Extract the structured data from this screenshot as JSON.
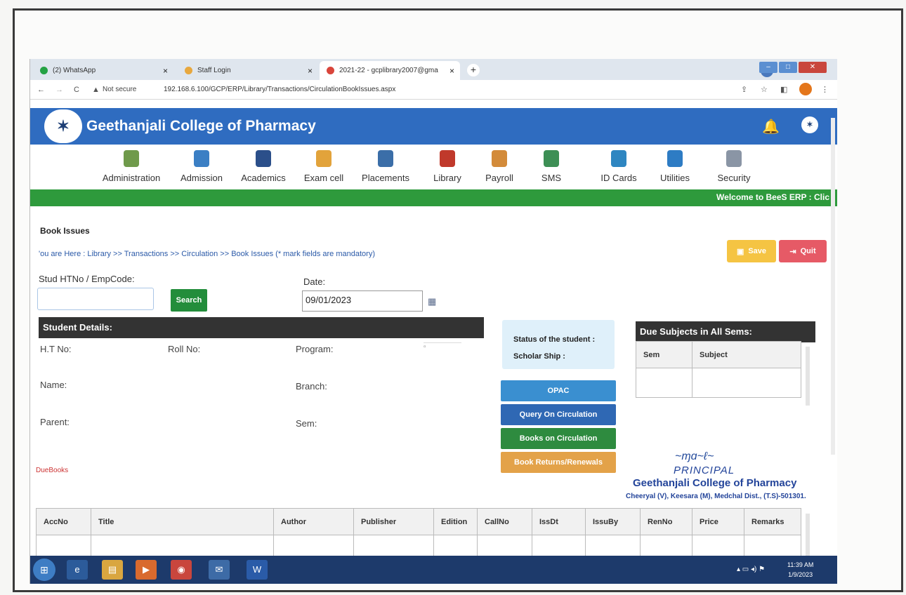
{
  "browser": {
    "tabs": [
      {
        "label": "(2) WhatsApp",
        "icon": "whatsapp-icon",
        "color": "#25a244"
      },
      {
        "label": "Staff Login",
        "icon": "staff-login-icon",
        "color": "#e8a83e"
      },
      {
        "label": "2021-22 - gcplibrary2007@gma",
        "icon": "gmail-icon",
        "color": "#d9453b"
      }
    ],
    "new_tab": "+",
    "not_secure": "Not secure",
    "url": "192.168.6.100/GCP/ERP/Library/Transactions/CirculationBookIssues.aspx"
  },
  "header": {
    "college_name": "Geethanjali College of Pharmacy"
  },
  "menu": [
    {
      "label": "Administration",
      "color": "#6f9a4b"
    },
    {
      "label": "Admission",
      "color": "#3b7fc4"
    },
    {
      "label": "Academics",
      "color": "#2b4f8a"
    },
    {
      "label": "Exam cell",
      "color": "#e2a33b"
    },
    {
      "label": "Placements",
      "color": "#3b6ea8"
    },
    {
      "label": "Library",
      "color": "#c0392b"
    },
    {
      "label": "Payroll",
      "color": "#d38b3a"
    },
    {
      "label": "SMS",
      "color": "#3d8f55"
    },
    {
      "label": "ID Cards",
      "color": "#2e86c1"
    },
    {
      "label": "Utilities",
      "color": "#2e7cc4"
    },
    {
      "label": "Security",
      "color": "#8a95a5"
    }
  ],
  "welcome": "Welcome to BeeS ERP : Clic",
  "page": {
    "title": "Book Issues",
    "breadcrumb": "'ou are Here : Library >> Transactions >> Circulation >> Book Issues (* mark fields are mandatory)",
    "save_label": "Save",
    "quit_label": "Quit",
    "htno_label": "Stud HTNo / EmpCode:",
    "search_label": "Search",
    "date_label": "Date:",
    "date_value": "09/01/2023"
  },
  "student": {
    "section_title": "Student Details:",
    "htno": "H.T No:",
    "rollno": "Roll No:",
    "program": "Program:",
    "name": "Name:",
    "branch": "Branch:",
    "parent": "Parent:",
    "sem": "Sem:",
    "duebooks": "DueBooks"
  },
  "status": {
    "status_label": "Status of the student :",
    "scholarship_label": "Scholar Ship :"
  },
  "actions": [
    {
      "label": "OPAC",
      "color": "#3a8fd0"
    },
    {
      "label": "Query On Circulation",
      "color": "#2f68b4"
    },
    {
      "label": "Books on Circulation",
      "color": "#2e8b3f"
    },
    {
      "label": "Book Returns/Renewals",
      "color": "#e3a249"
    }
  ],
  "due_subjects": {
    "title": "Due Subjects in All Sems:",
    "columns": [
      "Sem",
      "Subject"
    ]
  },
  "stamp": {
    "principal": "PRINCIPAL",
    "college": "Geethanjali College of Pharmacy",
    "address": "Cheeryal (V), Keesara (M), Medchal Dist., (T.S)-501301."
  },
  "books_table": {
    "columns": [
      "AccNo",
      "Title",
      "Author",
      "Publisher",
      "Edition",
      "CallNo",
      "IssDt",
      "IssuBy",
      "RenNo",
      "Price",
      "Remarks"
    ]
  },
  "taskbar": {
    "time": "11:39 AM",
    "date": "1/9/2023"
  }
}
